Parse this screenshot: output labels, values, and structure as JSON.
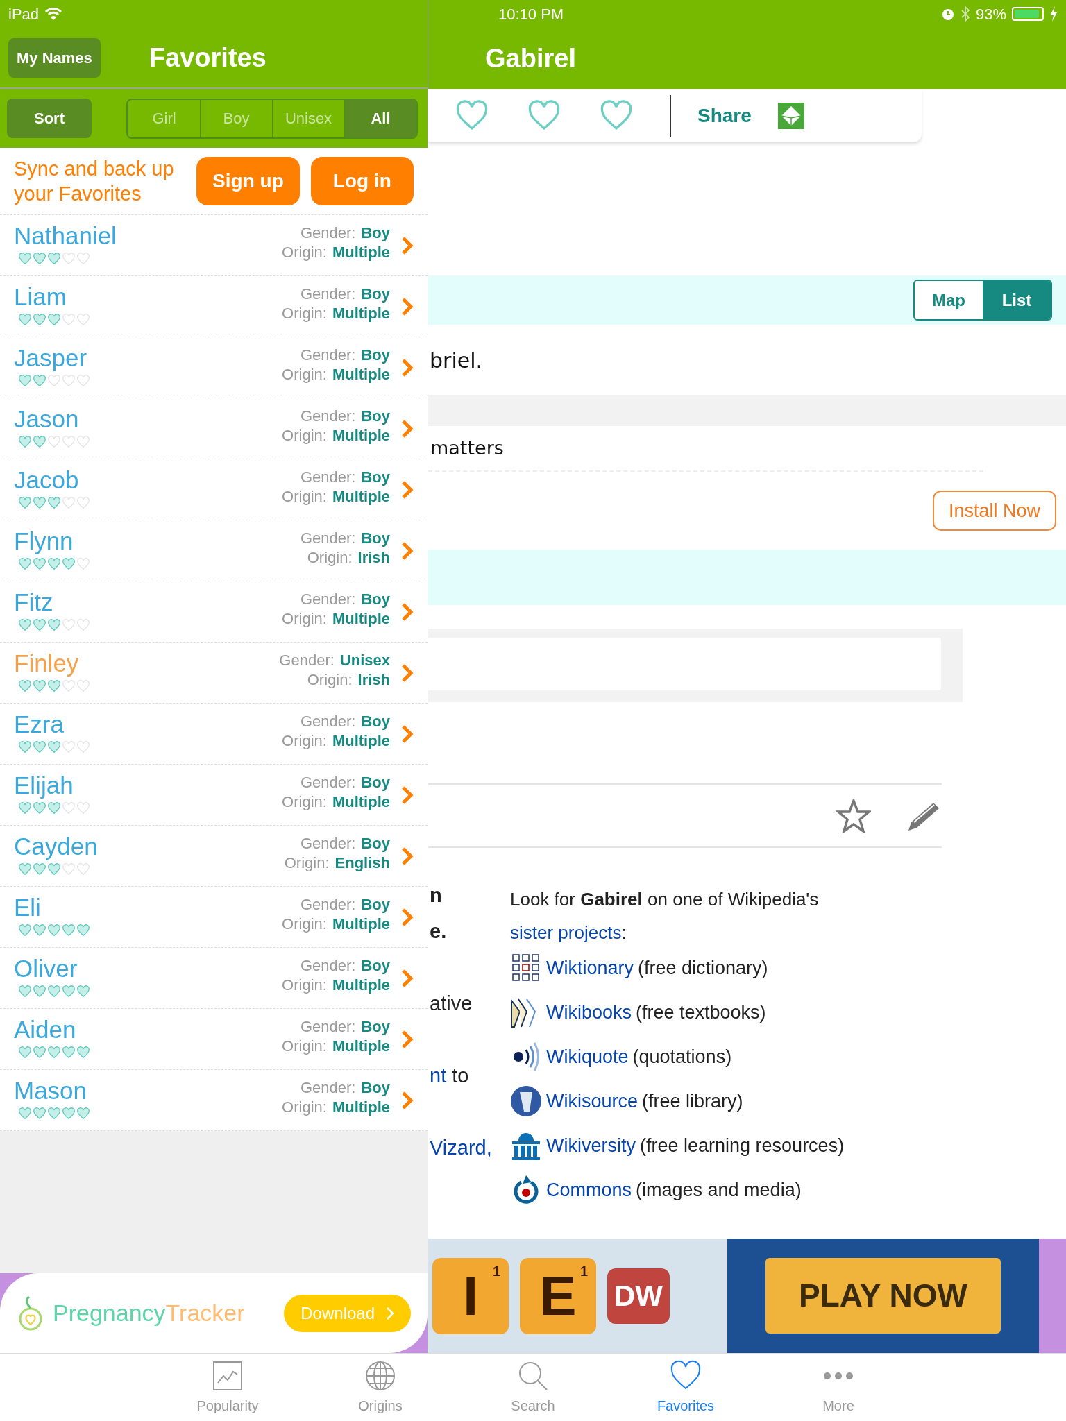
{
  "status_bar": {
    "device": "iPad",
    "time": "10:10 PM",
    "battery_text": "93%",
    "battery": {
      "level": 0.93
    }
  },
  "sidebar": {
    "my_names_button": "My Names",
    "title": "Favorites",
    "sort_button": "Sort",
    "filters": [
      {
        "label": "Girl",
        "selected": false
      },
      {
        "label": "Boy",
        "selected": false
      },
      {
        "label": "Unisex",
        "selected": false
      },
      {
        "label": "All",
        "selected": true
      }
    ],
    "sync": {
      "message": "Sync and back up your Favorites",
      "sign_up": "Sign up",
      "log_in": "Log in"
    },
    "rows": [
      {
        "name": "Nathaniel",
        "color": "#3aa8dc",
        "stars": 3,
        "gender_label": "Gender:",
        "gender": "Boy",
        "origin_label": "Origin:",
        "origin": "Multiple"
      },
      {
        "name": "Liam",
        "color": "#3aa8dc",
        "stars": 3,
        "gender_label": "Gender:",
        "gender": "Boy",
        "origin_label": "Origin:",
        "origin": "Multiple"
      },
      {
        "name": "Jasper",
        "color": "#3aa8dc",
        "stars": 2,
        "gender_label": "Gender:",
        "gender": "Boy",
        "origin_label": "Origin:",
        "origin": "Multiple"
      },
      {
        "name": "Jason",
        "color": "#3aa8dc",
        "stars": 2,
        "gender_label": "Gender:",
        "gender": "Boy",
        "origin_label": "Origin:",
        "origin": "Multiple"
      },
      {
        "name": "Jacob",
        "color": "#3aa8dc",
        "stars": 3,
        "gender_label": "Gender:",
        "gender": "Boy",
        "origin_label": "Origin:",
        "origin": "Multiple"
      },
      {
        "name": "Flynn",
        "color": "#3aa8dc",
        "stars": 4,
        "gender_label": "Gender:",
        "gender": "Boy",
        "origin_label": "Origin:",
        "origin": "Irish"
      },
      {
        "name": "Fitz",
        "color": "#3aa8dc",
        "stars": 3,
        "gender_label": "Gender:",
        "gender": "Boy",
        "origin_label": "Origin:",
        "origin": "Multiple"
      },
      {
        "name": "Finley",
        "color": "#f7a04a",
        "stars": 3,
        "gender_label": "Gender:",
        "gender": "Unisex",
        "origin_label": "Origin:",
        "origin": "Irish"
      },
      {
        "name": "Ezra",
        "color": "#3aa8dc",
        "stars": 3,
        "gender_label": "Gender:",
        "gender": "Boy",
        "origin_label": "Origin:",
        "origin": "Multiple"
      },
      {
        "name": "Elijah",
        "color": "#3aa8dc",
        "stars": 3,
        "gender_label": "Gender:",
        "gender": "Boy",
        "origin_label": "Origin:",
        "origin": "Multiple"
      },
      {
        "name": "Cayden",
        "color": "#3aa8dc",
        "stars": 3,
        "gender_label": "Gender:",
        "gender": "Boy",
        "origin_label": "Origin:",
        "origin": "English"
      },
      {
        "name": "Eli",
        "color": "#3aa8dc",
        "stars": 5,
        "gender_label": "Gender:",
        "gender": "Boy",
        "origin_label": "Origin:",
        "origin": "Multiple"
      },
      {
        "name": "Oliver",
        "color": "#3aa8dc",
        "stars": 5,
        "gender_label": "Gender:",
        "gender": "Boy",
        "origin_label": "Origin:",
        "origin": "Multiple"
      },
      {
        "name": "Aiden",
        "color": "#3aa8dc",
        "stars": 5,
        "gender_label": "Gender:",
        "gender": "Boy",
        "origin_label": "Origin:",
        "origin": "Multiple"
      },
      {
        "name": "Mason",
        "color": "#3aa8dc",
        "stars": 5,
        "gender_label": "Gender:",
        "gender": "Boy",
        "origin_label": "Origin:",
        "origin": "Multiple"
      }
    ],
    "ad": {
      "brand_first": "Pregnancy",
      "brand_second": "Tracker",
      "button": "Download"
    }
  },
  "detail": {
    "title": "Gabirel",
    "share": "Share",
    "views": [
      {
        "label": "Map",
        "selected": false
      },
      {
        "label": "List",
        "selected": true
      }
    ],
    "fragment_1": "briel.",
    "fragment_2": "matters",
    "install_button": "Install Now",
    "side_fragments": [
      {
        "text": "n",
        "bold": true
      },
      {
        "text": "e.",
        "bold": true
      },
      {
        "text": "ative"
      },
      {
        "link": "nt",
        "text": " to"
      },
      {
        "link": "Vizard,"
      }
    ],
    "sister_projects": {
      "parts": [
        {
          "text": "Look for **Gabirel** on one of Wikipedia's "
        },
        {
          "link": "sister"
        },
        {
          "link": "projects"
        },
        {
          "text": ":"
        }
      ],
      "items": [
        {
          "kind": "glyphs",
          "name": "Wiktionary",
          "desc": "(free dictionary)"
        },
        {
          "kind": "books",
          "name": "Wikibooks",
          "desc": "(free textbooks)"
        },
        {
          "kind": "waves",
          "name": "Wikiquote",
          "desc": "(quotations)"
        },
        {
          "kind": "emblem",
          "name": "Wikisource",
          "desc": "(free library)"
        },
        {
          "kind": "building",
          "name": "Wikiversity",
          "desc": "(free learning resources)"
        },
        {
          "kind": "arrow",
          "name": "Commons",
          "desc": "(images and media)"
        }
      ]
    },
    "game_ad": {
      "tiles": [
        {
          "letter": "I",
          "score": "1"
        },
        {
          "letter": "E",
          "score": "1"
        },
        {
          "letter": "DW"
        }
      ],
      "button": "PLAY NOW"
    }
  },
  "tab_bar": [
    {
      "label": "Popularity",
      "selected": false
    },
    {
      "label": "Origins",
      "selected": false
    },
    {
      "label": "Search",
      "selected": false
    },
    {
      "label": "Favorites",
      "selected": true
    },
    {
      "label": "More",
      "selected": false
    }
  ]
}
